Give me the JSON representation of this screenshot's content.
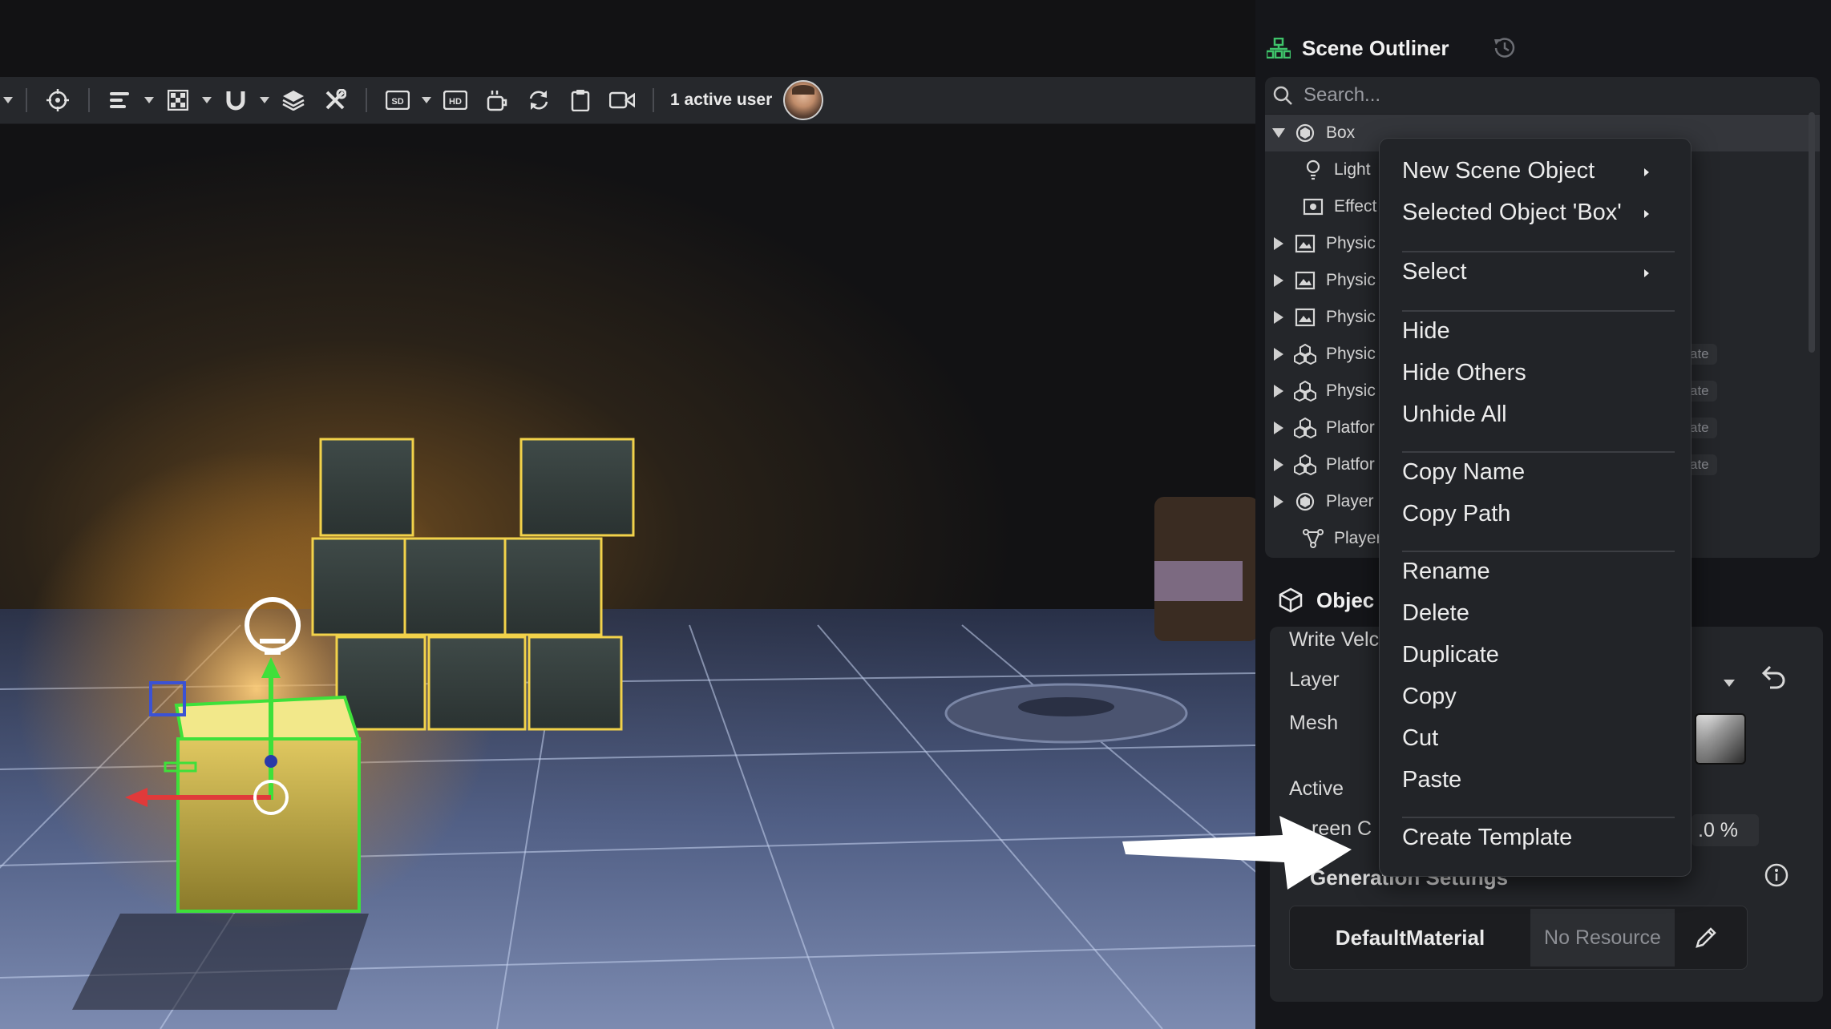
{
  "toolbar": {
    "active_users_label": "1 active user",
    "icons": [
      "crosshair-icon",
      "align-icon",
      "grid-icon",
      "magnet-icon",
      "layers-icon",
      "tools-icon",
      "sd-icon",
      "hd-icon",
      "snapshot-icon",
      "refresh-icon",
      "clipboard-icon",
      "camera-icon"
    ],
    "sd_label": "SD",
    "hd_label": "HD"
  },
  "outliner": {
    "title": "Scene Outliner",
    "search_placeholder": "Search...",
    "items": [
      {
        "label": "Box",
        "icon": "object-icon",
        "expanded": true,
        "selected": true
      },
      {
        "label": "Light",
        "icon": "light-icon",
        "child": true
      },
      {
        "label": "Effect V",
        "icon": "effect-icon",
        "child": true
      },
      {
        "label": "Physic",
        "icon": "image-icon"
      },
      {
        "label": "Physic",
        "icon": "image-icon"
      },
      {
        "label": "Physic",
        "icon": "image-icon"
      },
      {
        "label": "Physic",
        "icon": "prefab-icon",
        "badge": "ate"
      },
      {
        "label": "Physic",
        "icon": "prefab-icon",
        "badge": "ate"
      },
      {
        "label": "Platfor",
        "icon": "prefab-icon",
        "badge": "ate"
      },
      {
        "label": "Platfor",
        "icon": "prefab-icon",
        "badge": "ate"
      },
      {
        "label": "Player",
        "icon": "object-icon"
      },
      {
        "label": "Player",
        "icon": "graph-icon",
        "child": true
      }
    ]
  },
  "object_panel": {
    "title": "Objec",
    "props": {
      "write_velocity": "Write Velc",
      "layer": "Layer",
      "mesh": "Mesh",
      "active": "Active",
      "screen_coverage": "reen C"
    },
    "percent_value": ".0 %",
    "generation_settings": "Generation Settings",
    "material": {
      "name": "DefaultMaterial",
      "resource": "No Resource"
    }
  },
  "context_menu": {
    "items": [
      {
        "label": "New Scene Object",
        "submenu": true
      },
      {
        "label": "Selected Object 'Box'",
        "submenu": true
      },
      {
        "label": "Select",
        "submenu": true
      },
      {
        "label": "Hide"
      },
      {
        "label": "Hide Others"
      },
      {
        "label": "Unhide All"
      },
      {
        "label": "Copy Name"
      },
      {
        "label": "Copy Path"
      },
      {
        "label": "Rename"
      },
      {
        "label": "Delete"
      },
      {
        "label": "Duplicate"
      },
      {
        "label": "Copy"
      },
      {
        "label": "Cut"
      },
      {
        "label": "Paste"
      },
      {
        "label": "Create Template"
      }
    ]
  },
  "colors": {
    "gizmo_green": "#3ee03a",
    "gizmo_red": "#e03a3a",
    "cube_edge": "#f2d24a",
    "outliner_accent": "#3fc36a"
  }
}
